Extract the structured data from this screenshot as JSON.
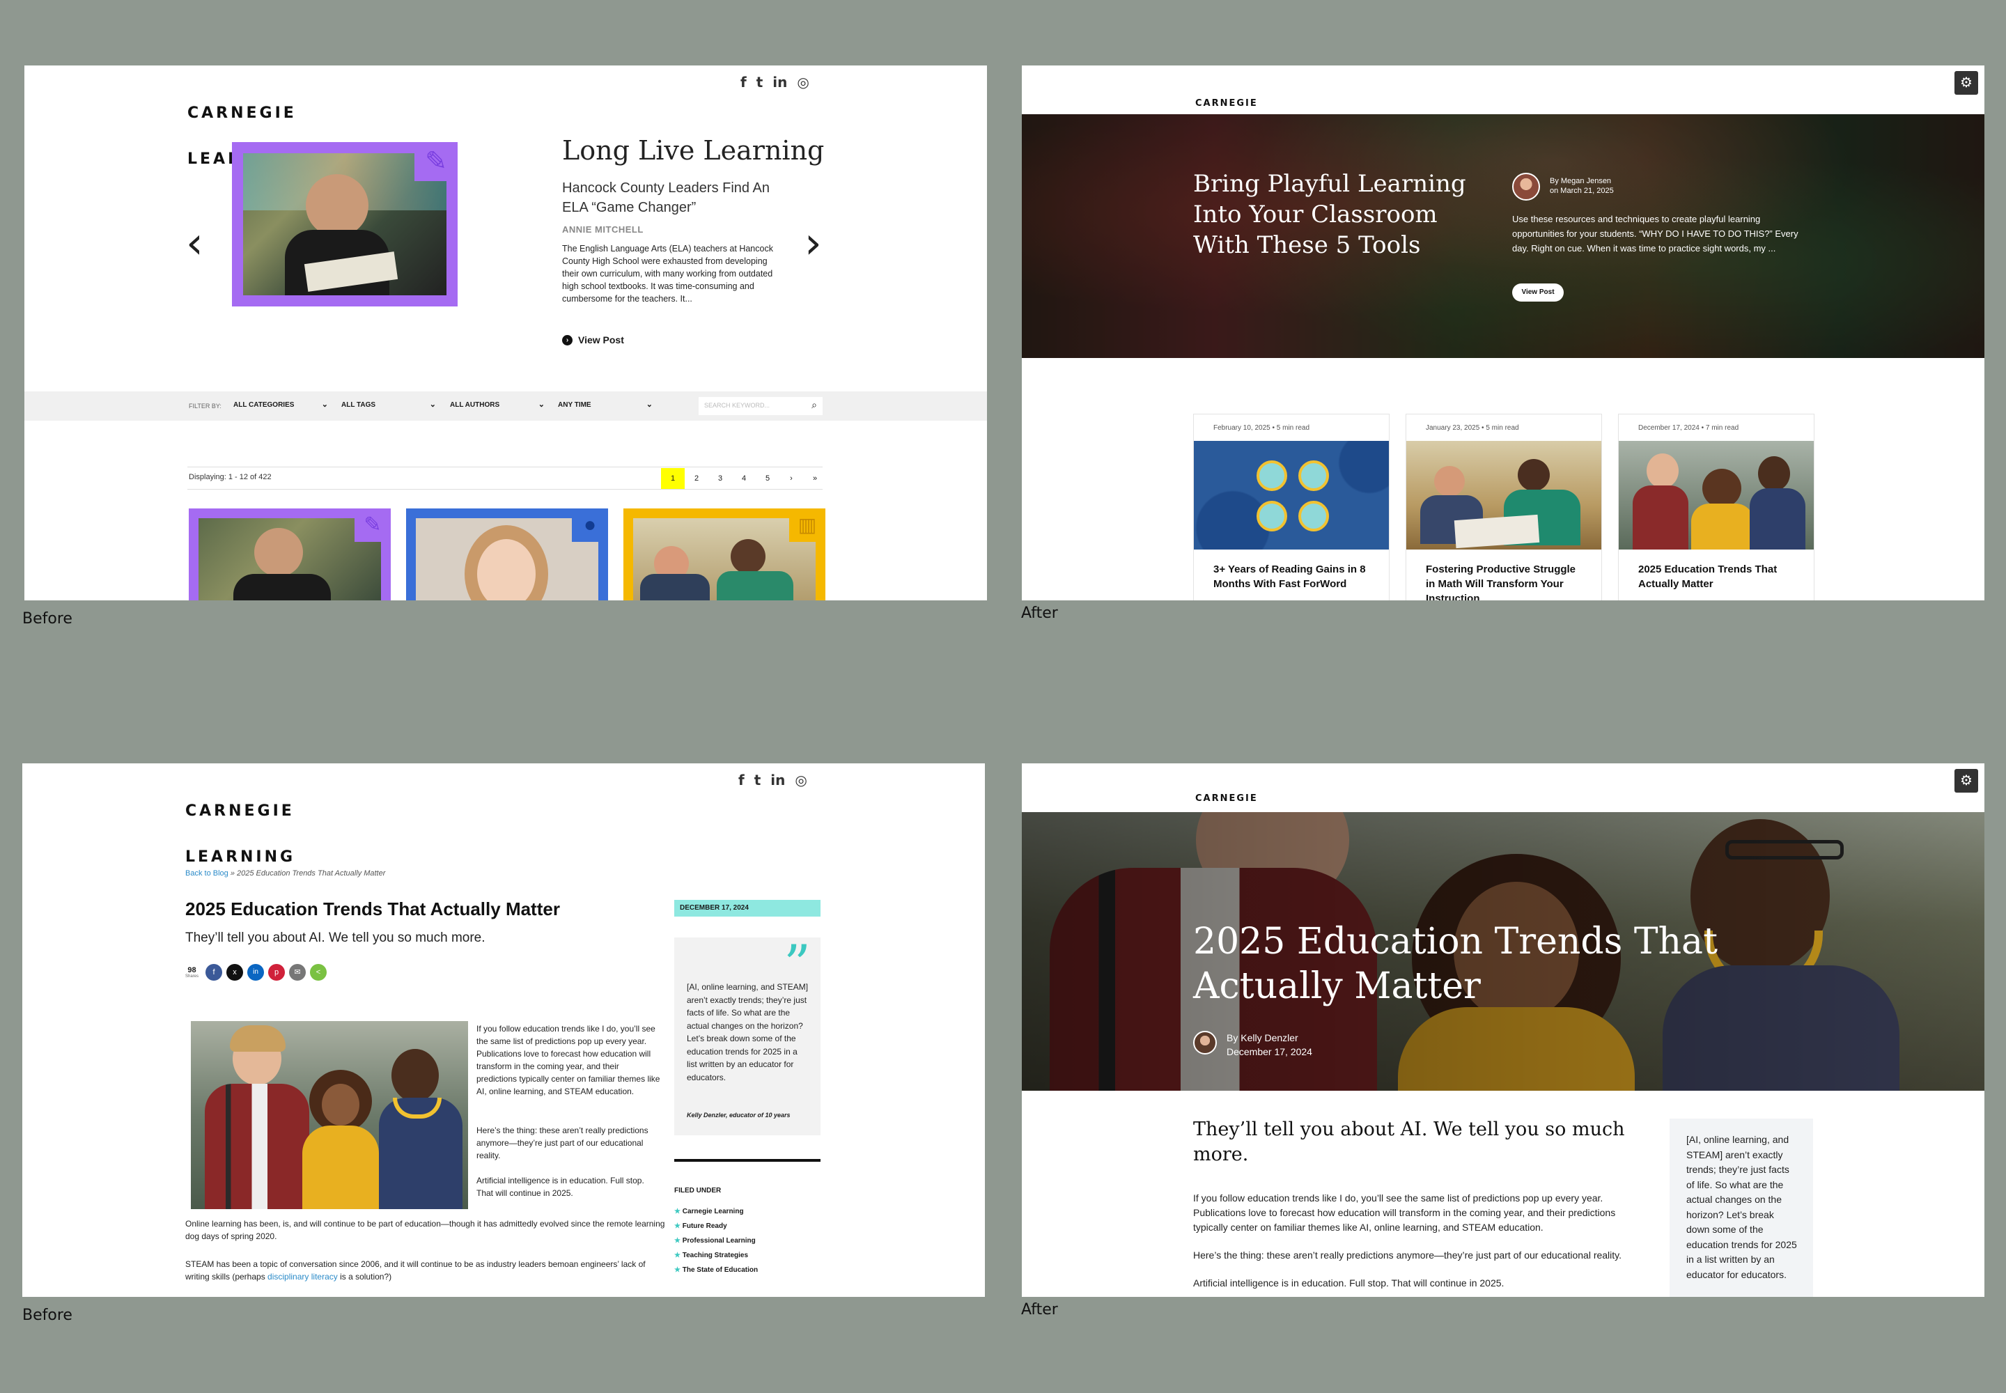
{
  "captions": {
    "before": "Before",
    "after": "After"
  },
  "brand": {
    "logo_line1": "CARNEGIE",
    "logo_line2": "LEARNING"
  },
  "social_icons": [
    "facebook-icon",
    "twitter-icon",
    "linkedin-icon",
    "instagram-icon"
  ],
  "colors": {
    "purple": "#a56bf2",
    "blue": "#3a6fd8",
    "yellow": "#f5b800",
    "cyan": "#8ee8e0",
    "page_active": "#ffff00"
  },
  "tl": {
    "hero_title": "Long Live Learning",
    "post_title": "Hancock County Leaders Find An ELA “Game Changer”",
    "author": "ANNIE MITCHELL",
    "excerpt": "The English Language Arts (ELA) teachers at Hancock County High School were exhausted from developing their own curriculum, with many working from outdated high school textbooks.  It was time-consuming and cumbersome for the teachers. It...",
    "view_post": "View Post",
    "prev": "‹",
    "next": "›",
    "filter_by": "FILTER BY:",
    "filters": [
      "ALL CATEGORIES",
      "ALL TAGS",
      "ALL AUTHORS",
      "ANY TIME"
    ],
    "search_placeholder": "SEARCH KEYWORD...",
    "displaying": "Displaying: 1 - 12 of 422",
    "pages": [
      "1",
      "2",
      "3",
      "4",
      "5",
      "›",
      "»"
    ]
  },
  "tr": {
    "hero_title": "Bring Playful Learning Into Your Classroom With These 5 Tools",
    "by": "By Megan Jensen",
    "on": "on March 21, 2025",
    "excerpt": "Use these resources and techniques to create playful learning opportunities for your students. “WHY DO I HAVE TO DO THIS?” Every day. Right on cue. When it was time to practice sight words, my ...",
    "view_post": "View Post",
    "cards": [
      {
        "meta": "February 10, 2025  •  5 min read",
        "title": "3+ Years of Reading Gains in 8 Months With Fast ForWord"
      },
      {
        "meta": "January 23, 2025  •  5 min read",
        "title": "Fostering Productive Struggle in Math Will Transform Your Instruction"
      },
      {
        "meta": "December 17, 2024  •  7 min read",
        "title": "2025 Education Trends That Actually Matter"
      }
    ]
  },
  "bl": {
    "breadcrumb_link": "Back to Blog",
    "breadcrumb_current": "» 2025 Education Trends That Actually Matter",
    "title": "2025 Education Trends That Actually Matter",
    "subtitle": "They’ll tell you about AI. We tell you so much more.",
    "shares_count": "98",
    "shares_label": "Shares",
    "share_icons": [
      "facebook-share-icon",
      "x-share-icon",
      "linkedin-share-icon",
      "pinterest-share-icon",
      "email-share-icon",
      "sharethis-icon"
    ],
    "para1": "If you follow education trends like I do, you’ll see the same list of predictions pop up every year. Publications love to forecast how education will transform in the coming year, and their predictions typically center on familiar themes like AI, online learning, and STEAM education.",
    "para2": "Here’s the thing: these aren’t really predictions anymore—they’re just part of our educational reality.",
    "para3": "Artificial intelligence is in education. Full stop. That will continue in 2025.",
    "para4": "Online learning has been, is, and will continue to be part of education—though it has admittedly evolved since the remote learning dog days of spring 2020.",
    "para5_a": "STEAM has been a topic of conversation since 2006, and it will continue to be as industry leaders bemoan engineers’ lack of writing skills (perhaps ",
    "para5_link": "disciplinary literacy",
    "para5_b": " is a solution?)",
    "date_badge": "DECEMBER 17, 2024",
    "quote_mark": "”",
    "quote": "[AI, online learning, and STEAM] aren’t exactly trends; they’re just facts of life. So what are the actual changes on the horizon? Let’s break down some of the education trends for 2025 in a list written by an educator for educators.",
    "quote_attr": "Kelly Denzler, educator of 10 years",
    "filed_under": "FILED UNDER",
    "categories": [
      "Carnegie Learning",
      "Future Ready",
      "Professional Learning",
      "Teaching Strategies",
      "The State of Education"
    ]
  },
  "br": {
    "hero_title": "2025 Education Trends That Actually Matter",
    "by": "By Kelly Denzler",
    "date": "December 17, 2024",
    "subtitle": "They’ll tell you about AI. We tell you so much more.",
    "para1": "If you follow education trends like I do, you’ll see the same list of predictions pop up every year. Publications love to forecast how education will transform in the coming year, and their predictions typically center on familiar themes like AI, online learning, and STEAM education.",
    "para2": "Here’s the thing: these aren’t really predictions anymore—they’re just part of our educational reality.",
    "para3": "Artificial intelligence is in education. Full stop. That will continue in 2025.",
    "quote": "[AI, online learning, and STEAM] aren’t exactly trends; they’re just facts of life. So what are the actual changes on the horizon? Let’s break down some of the education trends for 2025 in a list written by an educator for educators."
  }
}
